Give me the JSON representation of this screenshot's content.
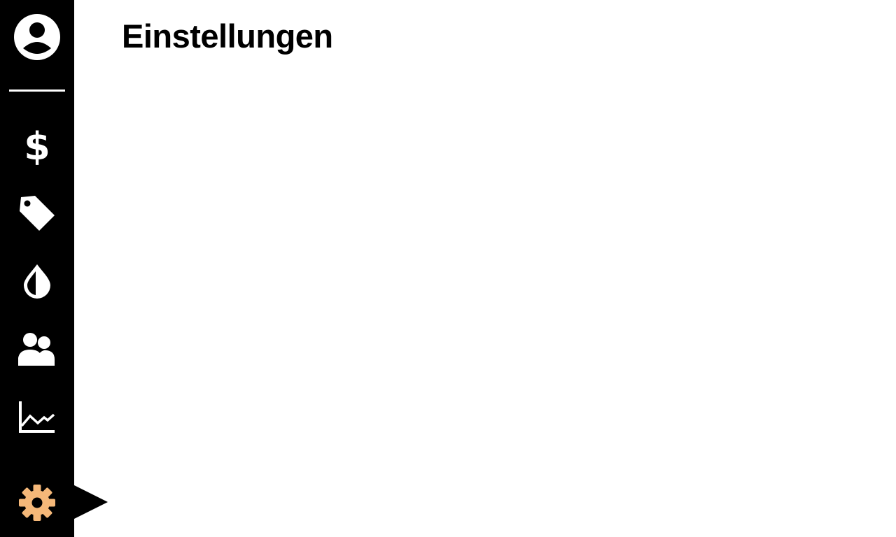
{
  "page": {
    "title": "Einstellungen"
  },
  "sidebar": {
    "items": [
      {
        "id": "account",
        "icon": "account-circle-icon",
        "active": false
      },
      {
        "id": "prices",
        "icon": "dollar-icon",
        "active": false
      },
      {
        "id": "tags",
        "icon": "tag-icon",
        "active": false
      },
      {
        "id": "contrast",
        "icon": "contrast-drop-icon",
        "active": false
      },
      {
        "id": "users",
        "icon": "people-icon",
        "active": false
      },
      {
        "id": "statistics",
        "icon": "line-chart-icon",
        "active": false
      },
      {
        "id": "settings",
        "icon": "gear-icon",
        "active": true
      }
    ]
  },
  "colors": {
    "sidebar_bg": "#000000",
    "icon": "#ffffff",
    "active_icon": "#f5b879",
    "page_bg": "#ffffff"
  }
}
